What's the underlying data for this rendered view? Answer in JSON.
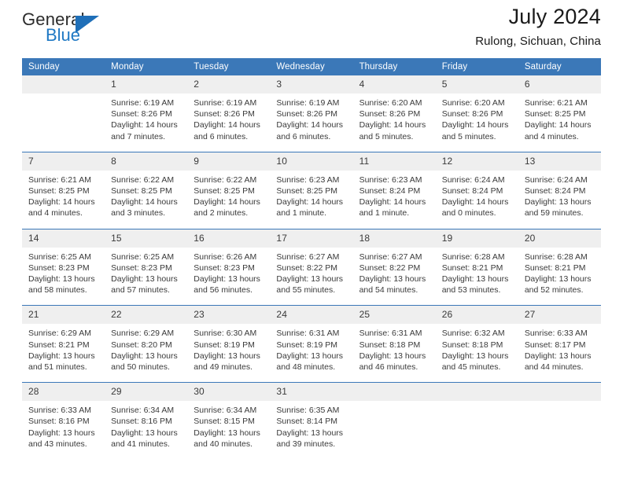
{
  "logo": {
    "word_one": "General",
    "word_two": "Blue",
    "triangle": "triangle-icon"
  },
  "header": {
    "title": "July 2024",
    "location": "Rulong, Sichuan, China"
  },
  "colors": {
    "header_blue": "#3b78b8",
    "logo_blue": "#2079c4",
    "daynum_band": "#efefef"
  },
  "weekdays": [
    "Sunday",
    "Monday",
    "Tuesday",
    "Wednesday",
    "Thursday",
    "Friday",
    "Saturday"
  ],
  "weeks": [
    [
      {
        "day": "",
        "sunrise": "",
        "sunset": "",
        "daylight_line1": "",
        "daylight_line2": ""
      },
      {
        "day": "1",
        "sunrise": "Sunrise: 6:19 AM",
        "sunset": "Sunset: 8:26 PM",
        "daylight_line1": "Daylight: 14 hours",
        "daylight_line2": "and 7 minutes."
      },
      {
        "day": "2",
        "sunrise": "Sunrise: 6:19 AM",
        "sunset": "Sunset: 8:26 PM",
        "daylight_line1": "Daylight: 14 hours",
        "daylight_line2": "and 6 minutes."
      },
      {
        "day": "3",
        "sunrise": "Sunrise: 6:19 AM",
        "sunset": "Sunset: 8:26 PM",
        "daylight_line1": "Daylight: 14 hours",
        "daylight_line2": "and 6 minutes."
      },
      {
        "day": "4",
        "sunrise": "Sunrise: 6:20 AM",
        "sunset": "Sunset: 8:26 PM",
        "daylight_line1": "Daylight: 14 hours",
        "daylight_line2": "and 5 minutes."
      },
      {
        "day": "5",
        "sunrise": "Sunrise: 6:20 AM",
        "sunset": "Sunset: 8:26 PM",
        "daylight_line1": "Daylight: 14 hours",
        "daylight_line2": "and 5 minutes."
      },
      {
        "day": "6",
        "sunrise": "Sunrise: 6:21 AM",
        "sunset": "Sunset: 8:25 PM",
        "daylight_line1": "Daylight: 14 hours",
        "daylight_line2": "and 4 minutes."
      }
    ],
    [
      {
        "day": "7",
        "sunrise": "Sunrise: 6:21 AM",
        "sunset": "Sunset: 8:25 PM",
        "daylight_line1": "Daylight: 14 hours",
        "daylight_line2": "and 4 minutes."
      },
      {
        "day": "8",
        "sunrise": "Sunrise: 6:22 AM",
        "sunset": "Sunset: 8:25 PM",
        "daylight_line1": "Daylight: 14 hours",
        "daylight_line2": "and 3 minutes."
      },
      {
        "day": "9",
        "sunrise": "Sunrise: 6:22 AM",
        "sunset": "Sunset: 8:25 PM",
        "daylight_line1": "Daylight: 14 hours",
        "daylight_line2": "and 2 minutes."
      },
      {
        "day": "10",
        "sunrise": "Sunrise: 6:23 AM",
        "sunset": "Sunset: 8:25 PM",
        "daylight_line1": "Daylight: 14 hours",
        "daylight_line2": "and 1 minute."
      },
      {
        "day": "11",
        "sunrise": "Sunrise: 6:23 AM",
        "sunset": "Sunset: 8:24 PM",
        "daylight_line1": "Daylight: 14 hours",
        "daylight_line2": "and 1 minute."
      },
      {
        "day": "12",
        "sunrise": "Sunrise: 6:24 AM",
        "sunset": "Sunset: 8:24 PM",
        "daylight_line1": "Daylight: 14 hours",
        "daylight_line2": "and 0 minutes."
      },
      {
        "day": "13",
        "sunrise": "Sunrise: 6:24 AM",
        "sunset": "Sunset: 8:24 PM",
        "daylight_line1": "Daylight: 13 hours",
        "daylight_line2": "and 59 minutes."
      }
    ],
    [
      {
        "day": "14",
        "sunrise": "Sunrise: 6:25 AM",
        "sunset": "Sunset: 8:23 PM",
        "daylight_line1": "Daylight: 13 hours",
        "daylight_line2": "and 58 minutes."
      },
      {
        "day": "15",
        "sunrise": "Sunrise: 6:25 AM",
        "sunset": "Sunset: 8:23 PM",
        "daylight_line1": "Daylight: 13 hours",
        "daylight_line2": "and 57 minutes."
      },
      {
        "day": "16",
        "sunrise": "Sunrise: 6:26 AM",
        "sunset": "Sunset: 8:23 PM",
        "daylight_line1": "Daylight: 13 hours",
        "daylight_line2": "and 56 minutes."
      },
      {
        "day": "17",
        "sunrise": "Sunrise: 6:27 AM",
        "sunset": "Sunset: 8:22 PM",
        "daylight_line1": "Daylight: 13 hours",
        "daylight_line2": "and 55 minutes."
      },
      {
        "day": "18",
        "sunrise": "Sunrise: 6:27 AM",
        "sunset": "Sunset: 8:22 PM",
        "daylight_line1": "Daylight: 13 hours",
        "daylight_line2": "and 54 minutes."
      },
      {
        "day": "19",
        "sunrise": "Sunrise: 6:28 AM",
        "sunset": "Sunset: 8:21 PM",
        "daylight_line1": "Daylight: 13 hours",
        "daylight_line2": "and 53 minutes."
      },
      {
        "day": "20",
        "sunrise": "Sunrise: 6:28 AM",
        "sunset": "Sunset: 8:21 PM",
        "daylight_line1": "Daylight: 13 hours",
        "daylight_line2": "and 52 minutes."
      }
    ],
    [
      {
        "day": "21",
        "sunrise": "Sunrise: 6:29 AM",
        "sunset": "Sunset: 8:21 PM",
        "daylight_line1": "Daylight: 13 hours",
        "daylight_line2": "and 51 minutes."
      },
      {
        "day": "22",
        "sunrise": "Sunrise: 6:29 AM",
        "sunset": "Sunset: 8:20 PM",
        "daylight_line1": "Daylight: 13 hours",
        "daylight_line2": "and 50 minutes."
      },
      {
        "day": "23",
        "sunrise": "Sunrise: 6:30 AM",
        "sunset": "Sunset: 8:19 PM",
        "daylight_line1": "Daylight: 13 hours",
        "daylight_line2": "and 49 minutes."
      },
      {
        "day": "24",
        "sunrise": "Sunrise: 6:31 AM",
        "sunset": "Sunset: 8:19 PM",
        "daylight_line1": "Daylight: 13 hours",
        "daylight_line2": "and 48 minutes."
      },
      {
        "day": "25",
        "sunrise": "Sunrise: 6:31 AM",
        "sunset": "Sunset: 8:18 PM",
        "daylight_line1": "Daylight: 13 hours",
        "daylight_line2": "and 46 minutes."
      },
      {
        "day": "26",
        "sunrise": "Sunrise: 6:32 AM",
        "sunset": "Sunset: 8:18 PM",
        "daylight_line1": "Daylight: 13 hours",
        "daylight_line2": "and 45 minutes."
      },
      {
        "day": "27",
        "sunrise": "Sunrise: 6:33 AM",
        "sunset": "Sunset: 8:17 PM",
        "daylight_line1": "Daylight: 13 hours",
        "daylight_line2": "and 44 minutes."
      }
    ],
    [
      {
        "day": "28",
        "sunrise": "Sunrise: 6:33 AM",
        "sunset": "Sunset: 8:16 PM",
        "daylight_line1": "Daylight: 13 hours",
        "daylight_line2": "and 43 minutes."
      },
      {
        "day": "29",
        "sunrise": "Sunrise: 6:34 AM",
        "sunset": "Sunset: 8:16 PM",
        "daylight_line1": "Daylight: 13 hours",
        "daylight_line2": "and 41 minutes."
      },
      {
        "day": "30",
        "sunrise": "Sunrise: 6:34 AM",
        "sunset": "Sunset: 8:15 PM",
        "daylight_line1": "Daylight: 13 hours",
        "daylight_line2": "and 40 minutes."
      },
      {
        "day": "31",
        "sunrise": "Sunrise: 6:35 AM",
        "sunset": "Sunset: 8:14 PM",
        "daylight_line1": "Daylight: 13 hours",
        "daylight_line2": "and 39 minutes."
      },
      {
        "day": "",
        "sunrise": "",
        "sunset": "",
        "daylight_line1": "",
        "daylight_line2": ""
      },
      {
        "day": "",
        "sunrise": "",
        "sunset": "",
        "daylight_line1": "",
        "daylight_line2": ""
      },
      {
        "day": "",
        "sunrise": "",
        "sunset": "",
        "daylight_line1": "",
        "daylight_line2": ""
      }
    ]
  ]
}
